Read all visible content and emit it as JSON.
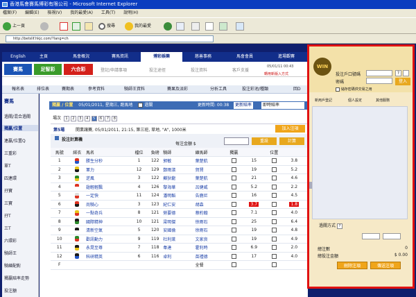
{
  "window": {
    "title": "香港馬會賽馬博彩有限公司 - Microsoft Internet Explorer"
  },
  "menu": [
    "檔案(F)",
    "編輯(E)",
    "檢視(V)",
    "我的最愛(A)",
    "工具(T)",
    "說明(H)"
  ],
  "toolbar": {
    "back": "上一頁",
    "search": "搜尋",
    "favorites": "我的最愛"
  },
  "address": {
    "url": "http://betslif.hkjc.com/?lang=ch"
  },
  "nav": {
    "english": "English",
    "items": [
      "主頁",
      "馬會概況",
      "賽馬資訊",
      "博彩娛樂",
      "慈善事務",
      "馬會會員",
      "進場觀賽"
    ]
  },
  "bigtabs": [
    "賽馬",
    "足智彩",
    "六合彩"
  ],
  "subtabs": [
    "登記/申請事項",
    "投注途徑",
    "投注資料",
    "客戶支援"
  ],
  "help_link": "轉用新版入方式",
  "datetime": "05/01/11 00:43",
  "secondary_nav": [
    "報名表",
    "排位表",
    "賽期表",
    "參考資料",
    "騎師王資料",
    "賽果及派彩",
    "分析工具",
    "投注彩池/種類",
    "回D"
  ],
  "sidebar": {
    "title": "賽馬",
    "items": [
      "過關/混合過關",
      "獨贏/位置",
      "連贏/位置Q",
      "三重彩",
      "單T",
      "四連環",
      "孖寶",
      "三寶",
      "孖T",
      "三T",
      "六環彩",
      "騎師王",
      "騎練配對",
      "獨贏賠率走勢",
      "投注額"
    ]
  },
  "race": {
    "header": "獨贏 / 位置",
    "info": "05/01/2011, 星期三, 跑馬地",
    "closed_label": "過關",
    "update_label": "更新時間: 00:38",
    "update_odds": "更新賠率",
    "odds_select": "即時賠率",
    "tabs_label": "場次",
    "race_tabs": [
      "1",
      "2",
      "3",
      "4",
      "5",
      "6",
      "7",
      "8"
    ],
    "race_no": "第5場",
    "race_detail": "開業讓賽, 05/01/2011, 21:15, 第三班, 草地, \"A\", 1000米",
    "add_bet": "加入注項",
    "calc_title": "投注計算機",
    "unit_label": "每注金額 $",
    "reset": "重設",
    "calculate": "計算"
  },
  "table": {
    "headers": [
      "馬號",
      "綵衣",
      "馬名",
      "檔位",
      "負磅",
      "騎師",
      "練馬師",
      "獨贏",
      "",
      "位置",
      ""
    ],
    "rows": [
      {
        "no": "1",
        "name": "勝生分秒",
        "draw": "1",
        "wt": "122",
        "jockey": "郭敏",
        "trainer": "葉楚航",
        "win": "15",
        "place": "3.8",
        "colors": [
          "#d32",
          "#2255c8"
        ],
        "hot": false
      },
      {
        "no": "2",
        "name": "軍力",
        "draw": "12",
        "wt": "129",
        "jockey": "鄭雨濱",
        "trainer": "賀賢",
        "win": "19",
        "place": "5.2",
        "colors": [
          "#e8c41a",
          "#1a1a1a"
        ],
        "hot": false
      },
      {
        "no": "3",
        "name": "逆風",
        "draw": "3",
        "wt": "122",
        "jockey": "蘇狄龍",
        "trainer": "葉楚航",
        "win": "21",
        "place": "4.6",
        "colors": [
          "#2a8a2a",
          "#e8c41a"
        ],
        "hot": false
      },
      {
        "no": "4",
        "name": "翅輕輕飄",
        "draw": "4",
        "wt": "126",
        "jockey": "黎海華",
        "trainer": "呂健威",
        "win": "5.2",
        "place": "2.2",
        "colors": [
          "#d32",
          "#fff"
        ],
        "hot": false
      },
      {
        "no": "5",
        "name": "一定快",
        "draw": "11",
        "wt": "124",
        "jockey": "潘明韜",
        "trainer": "告鹿尼",
        "win": "16",
        "place": "4.5",
        "colors": [
          "#ddd",
          "#d32"
        ],
        "hot": false
      },
      {
        "no": "6",
        "name": "尚騎心",
        "draw": "3",
        "wt": "123",
        "jockey": "紀仁安",
        "trainer": "胡森",
        "win": "3.7",
        "place": "1.8",
        "colors": [
          "#d32",
          "#1a1a1a"
        ],
        "hot": true
      },
      {
        "no": "7",
        "name": "一點奇兵",
        "draw": "8",
        "wt": "121",
        "jockey": "勞要德",
        "trainer": "蔡約翰",
        "win": "7.1",
        "place": "4.0",
        "colors": [
          "#e8c41a",
          "#d32"
        ],
        "hot": false
      },
      {
        "no": "8",
        "name": "國際精神",
        "draw": "10",
        "wt": "121",
        "jockey": "梁明傑",
        "trainer": "徐雨石",
        "win": "25",
        "place": "6.4",
        "colors": [
          "#1a1a1a",
          "#2a8a2a"
        ],
        "hot": false
      },
      {
        "no": "9",
        "name": "清新空氣",
        "draw": "5",
        "wt": "120",
        "jockey": "安國倫",
        "trainer": "徐雨石",
        "win": "19",
        "place": "4.8",
        "colors": [
          "#1a1a1a",
          "#fff"
        ],
        "hot": false
      },
      {
        "no": "10",
        "name": "歡訊動力",
        "draw": "9",
        "wt": "119",
        "jockey": "杜利萊",
        "trainer": "文家良",
        "win": "19",
        "place": "4.9",
        "colors": [
          "#2a8a2a",
          "#d32"
        ],
        "hot": false
      },
      {
        "no": "11",
        "name": "永晃至尊",
        "draw": "7",
        "wt": "118",
        "jockey": "韋達",
        "trainer": "霍利時",
        "win": "6.9",
        "place": "2.0",
        "colors": [
          "#1a1a1a",
          "#e8c41a"
        ],
        "hot": false
      },
      {
        "no": "12",
        "name": "科研精英",
        "draw": "6",
        "wt": "116",
        "jockey": "卓利",
        "trainer": "苗禮德",
        "win": "17",
        "place": "4.0",
        "colors": [
          "#1a1a1a",
          "#2255c8"
        ],
        "hot": false
      }
    ],
    "field_row": {
      "no": "F",
      "trainer": "全餐"
    }
  },
  "betslip": {
    "account_label": "投注戶口號碼",
    "password_label": "密碼",
    "login": "登入",
    "save_account": "儲存密碼供交易之用",
    "links": [
      "新用戶登記",
      "個人設定",
      "其他服務"
    ],
    "method_label": "過關方式",
    "total_label": "總注數",
    "total_value": "0",
    "amount_label": "總投注金額",
    "amount_value": "$ 0.00",
    "delete": "刪除注項",
    "send": "傳送注項",
    "logo": "WIN"
  },
  "colors": {
    "accent": "#e01111",
    "brand": "#122e8a",
    "win_hot": "#e01111"
  }
}
